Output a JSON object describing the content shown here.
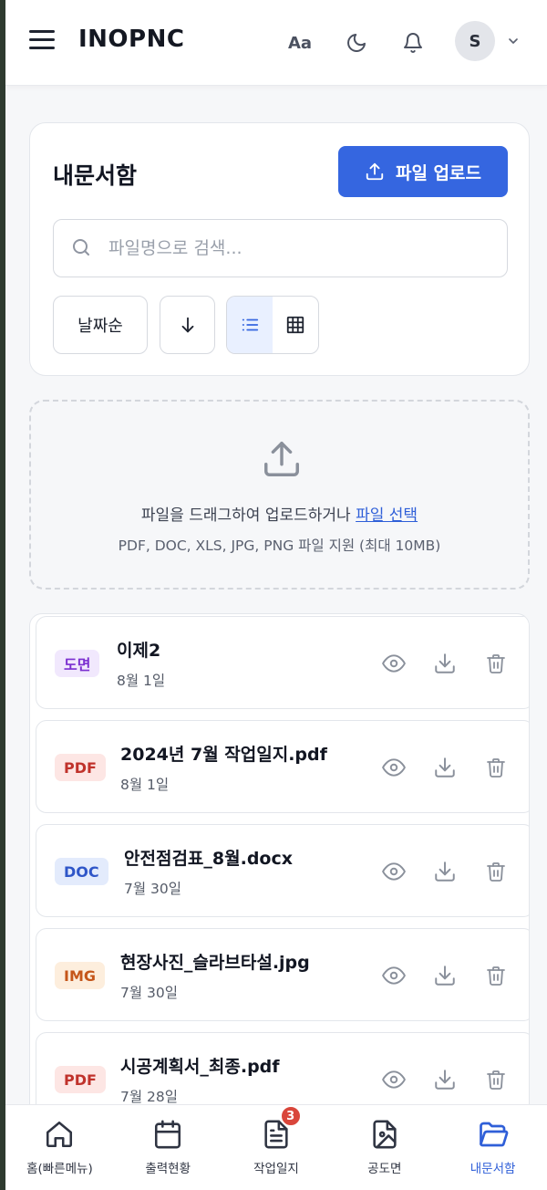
{
  "header": {
    "brand": "INOPNC",
    "font_size_label": "Aa",
    "avatar_initial": "S"
  },
  "documents": {
    "title": "내문서함",
    "upload_label": "파일 업로드",
    "search_placeholder": "파일명으로 검색...",
    "sort_label": "날짜순",
    "view_mode": "list"
  },
  "dropzone": {
    "text": "파일을 드래그하여 업로드하거나",
    "link": "파일 선택",
    "formats": "PDF, DOC, XLS, JPG, PNG 파일 지원 (최대 10MB)"
  },
  "files": [
    {
      "badge": "도면",
      "badge_color": "#7b2fd0",
      "badge_bg": "#f1e8fd",
      "name": "이제2",
      "date": "8월 1일"
    },
    {
      "badge": "PDF",
      "badge_color": "#c0322b",
      "badge_bg": "#fde6e4",
      "name": "2024년 7월 작업일지.pdf",
      "date": "8월 1일"
    },
    {
      "badge": "DOC",
      "badge_color": "#2f56c8",
      "badge_bg": "#e3ebfc",
      "name": "안전점검표_8월.docx",
      "date": "7월 30일"
    },
    {
      "badge": "IMG",
      "badge_color": "#c5561a",
      "badge_bg": "#fdeedd",
      "name": "현장사진_슬라브타설.jpg",
      "date": "7월 30일"
    },
    {
      "badge": "PDF",
      "badge_color": "#c0322b",
      "badge_bg": "#fde6e4",
      "name": "시공계획서_최종.pdf",
      "date": "7월 28일"
    }
  ],
  "bottom_nav": {
    "items": [
      {
        "label": "홈(빠른메뉴)",
        "icon": "home-icon"
      },
      {
        "label": "출력현황",
        "icon": "calendar-icon"
      },
      {
        "label": "작업일지",
        "icon": "document-icon",
        "badge": "3"
      },
      {
        "label": "공도면",
        "icon": "image-file-icon"
      },
      {
        "label": "내문서함",
        "icon": "folder-open-icon",
        "active": true
      }
    ]
  },
  "colors": {
    "accent": "#3566e0",
    "active_nav": "#2f5fd8"
  }
}
